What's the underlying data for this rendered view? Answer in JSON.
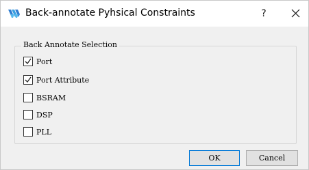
{
  "window": {
    "title": "Back-annotate Pyhsical Constraints",
    "help_label": "?",
    "icon": "gowin-logo-icon",
    "close_icon": "close-icon"
  },
  "group": {
    "title": "Back Annotate Selection",
    "options": [
      {
        "label": "Port",
        "checked": true
      },
      {
        "label": "Port Attribute",
        "checked": true
      },
      {
        "label": "BSRAM",
        "checked": false
      },
      {
        "label": "DSP",
        "checked": false
      },
      {
        "label": "PLL",
        "checked": false
      }
    ]
  },
  "buttons": {
    "ok_label": "OK",
    "cancel_label": "Cancel"
  }
}
